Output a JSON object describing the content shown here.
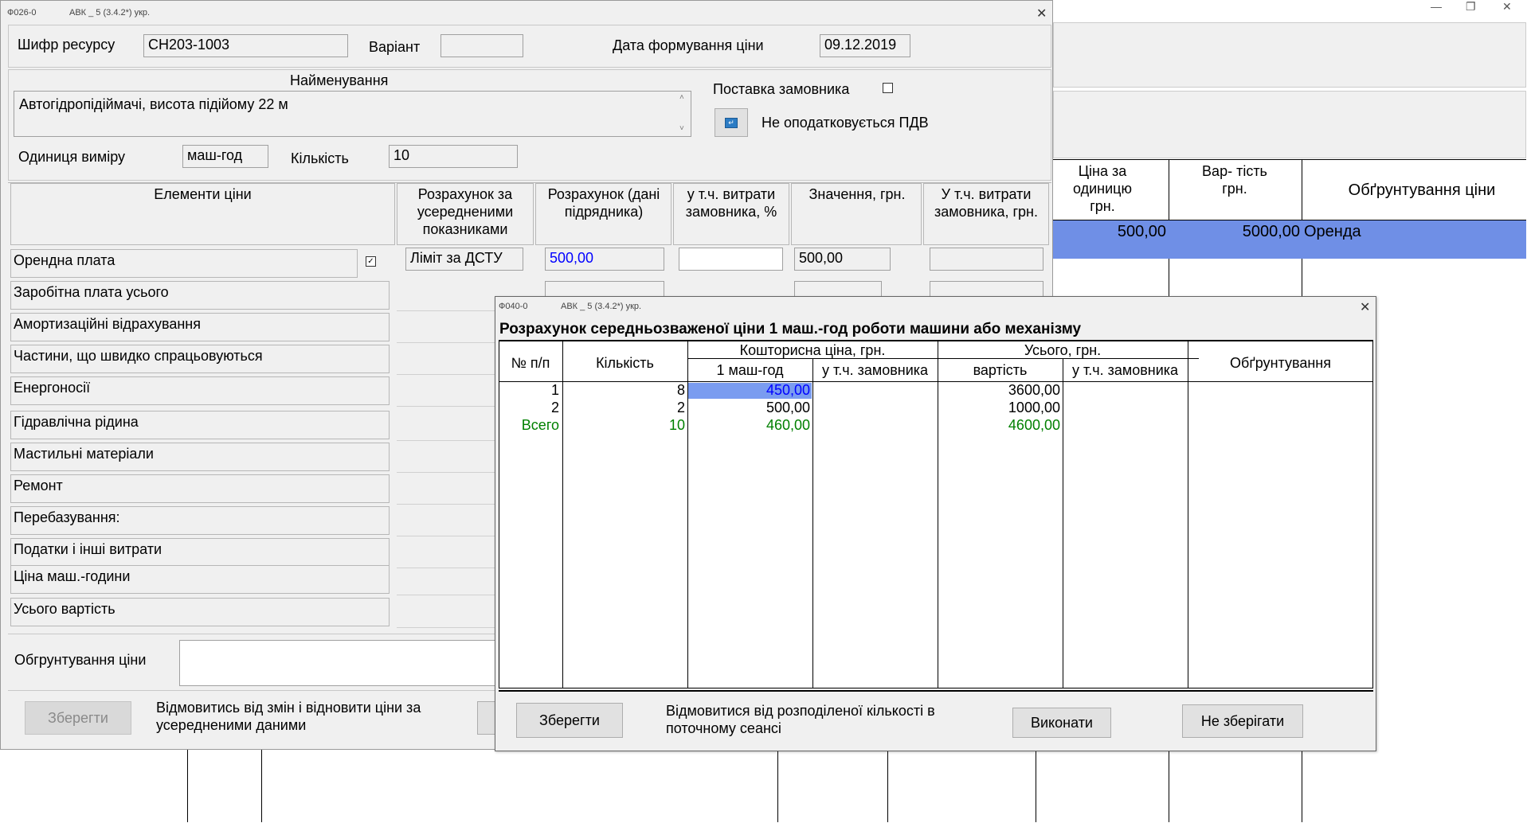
{
  "outer": {
    "controls": {
      "minimize": "—",
      "restore": "❐",
      "close": "✕"
    },
    "grid": {
      "headers": [
        "Ціна за одиницю грн.",
        "Вар- тість грн.",
        "Обґрунтування ціни"
      ],
      "row": {
        "price": "500,00",
        "cost": "5000,00",
        "reason": "Оренда"
      }
    }
  },
  "form026": {
    "title": "Ф026-0",
    "app": "АВК _ 5 (3.4.2*) укр.",
    "close": "✕",
    "code_label": "Шифр ресурсу",
    "code_value": "СН203-1003",
    "variant_label": "Варіант",
    "variant_value": "",
    "date_label": "Дата формування ціни",
    "date_value": "09.12.2019",
    "name_label": "Найменування",
    "name_value": "Автогідропідіймачі, висота підійому 22 м",
    "supply_label": "Поставка замовника",
    "vat_label": "Не оподатковується ПДВ",
    "unit_label": "Одиниця виміру",
    "unit_value": "маш-год",
    "qty_label": "Кількість",
    "qty_value": "10",
    "headers": {
      "elements": "Елементи ціни",
      "averaged": "Розрахунок за усередненими показниками",
      "contractor": "Розрахунок (дані підрядника)",
      "customer_pct": "у т.ч. витрати замовника, %",
      "value": "Значення, грн.",
      "customer_uah": "У т.ч. витрати замовника, грн."
    },
    "rent": {
      "label": "Орендна плата",
      "limit": "Ліміт за ДСТУ",
      "contractor": "500,00",
      "pct": "",
      "value": "500,00",
      "customer": ""
    },
    "rows": [
      "Заробітна плата усього",
      "Амортизаційні відрахування",
      "Частини, що швидко спрацьовуються",
      "Енергоносії",
      "Гідравлічна рідина",
      "Мастильні матеріали",
      "Ремонт",
      "Перебазування:",
      "Податки  і інші витрати",
      "Ціна маш.-години",
      "Усього вартість"
    ],
    "reason_label": "Обгрунтування ціни",
    "reason_value": "",
    "save_btn": "Зберегти",
    "revert_text": "Відмовитись від змін і відновити ціни за усередненими даними"
  },
  "form040": {
    "title": "Ф040-0",
    "app": "АВК _ 5 (3.4.2*) укр.",
    "close": "✕",
    "heading": "Розрахунок середньозваженої ціни 1 маш.-год роботи машини або механізму",
    "headers": {
      "num": "№ п/п",
      "qty": "Кількість",
      "est_group": "Кошторисна ціна, грн.",
      "per_hour": "1 маш-год",
      "incl_customer": "у т.ч. замовника",
      "total_group": "Усього, грн.",
      "cost": "вартість",
      "incl_customer2": "у т.ч. замовника",
      "reason": "Обґрунтування"
    },
    "rows": [
      {
        "n": "1",
        "qty": "8",
        "price": "450,00",
        "cost": "3600,00"
      },
      {
        "n": "2",
        "qty": "2",
        "price": "500,00",
        "cost": "1000,00"
      }
    ],
    "total": {
      "n": "Всего",
      "qty": "10",
      "price": "460,00",
      "cost": "4600,00"
    },
    "save_btn": "Зберегти",
    "refuse_text": "Відмовитися від розподіленої кількості в поточному сеансі",
    "run_btn": "Виконати",
    "nosave_btn": "Не зберігати"
  },
  "colors": {
    "selection": "#6f8fe6",
    "cell_selection": "#7a9cf0",
    "blue_text": "#0000ff",
    "green_text": "#008000"
  },
  "icons": {
    "checkbox": "checkbox-icon",
    "vat_button": "arrow-return-icon"
  }
}
